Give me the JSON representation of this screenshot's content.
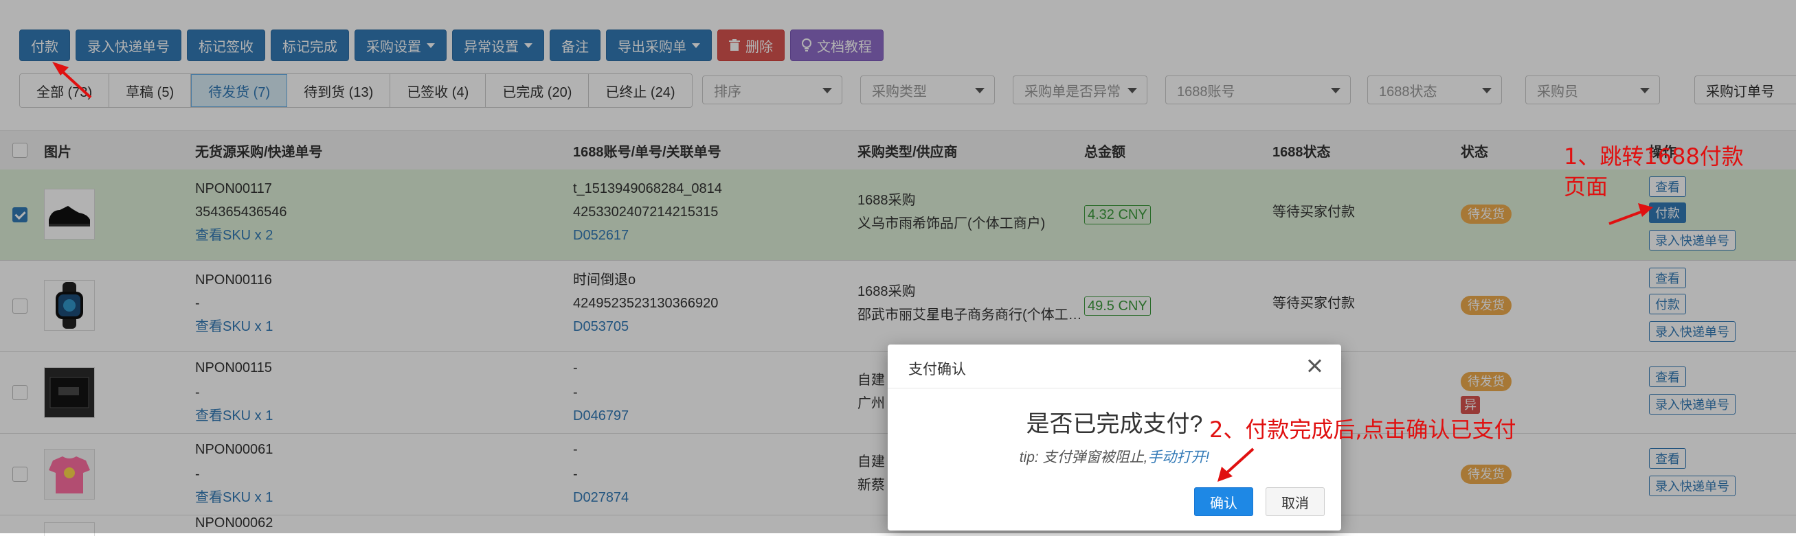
{
  "toolbar": {
    "buttons": [
      {
        "label": "付款"
      },
      {
        "label": "录入快递单号"
      },
      {
        "label": "标记签收"
      },
      {
        "label": "标记完成"
      },
      {
        "label": "采购设置"
      },
      {
        "label": "异常设置"
      },
      {
        "label": "备注"
      },
      {
        "label": "导出采购单"
      },
      {
        "label": "删除"
      },
      {
        "label": "文档教程"
      }
    ]
  },
  "tabs": [
    {
      "label": "全部 (73)"
    },
    {
      "label": "草稿 (5)"
    },
    {
      "label": "待发货 (7)",
      "active": true
    },
    {
      "label": "待到货 (13)"
    },
    {
      "label": "已签收 (4)"
    },
    {
      "label": "已完成 (20)"
    },
    {
      "label": "已终止 (24)"
    }
  ],
  "filters": {
    "sort": "排序",
    "purchase_type": "采购类型",
    "is_abnormal": "采购单是否异常",
    "account_1688": "1688账号",
    "status_1688": "1688状态",
    "buyer": "采购员",
    "search_field": "采购订单号"
  },
  "table": {
    "headers": {
      "image": "图片",
      "order_no": "无货源采购/快递单号",
      "account": "1688账号/单号/关联单号",
      "type_supplier": "采购类型/供应商",
      "total": "总金额",
      "status_1688": "1688状态",
      "status": "状态",
      "ops": "操作"
    },
    "rows": [
      {
        "order": "NPON00117",
        "express": "354365436546",
        "sku": "查看SKU x 2",
        "account": "t_1513949068284_0814",
        "order_1688": "4253302407214215315",
        "related": "D052617",
        "type": "1688采购",
        "supplier": "义乌市雨希饰品厂(个体工商户)",
        "amount": "4.32 CNY",
        "status_1688": "等待买家付款",
        "status": "待发货"
      },
      {
        "order": "NPON00116",
        "express": "-",
        "sku": "查看SKU x 1",
        "account": "时间倒退o",
        "order_1688": "4249523523130366920",
        "related": "D053705",
        "type": "1688采购",
        "supplier": "邵武市丽艾星电子商务商行(个体工…",
        "amount": "49.5 CNY",
        "status_1688": "等待买家付款",
        "status": "待发货"
      },
      {
        "order": "NPON00115",
        "express": "-",
        "sku": "查看SKU x 1",
        "account": "-",
        "order_1688": "-",
        "related": "D046797",
        "type": "自建",
        "supplier": "广州",
        "status": "待发货",
        "abnormal": "异"
      },
      {
        "order": "NPON00061",
        "express": "-",
        "sku": "查看SKU x 1",
        "account": "-",
        "order_1688": "-",
        "related": "D027874",
        "type": "自建",
        "supplier": "新蔡",
        "status": "待发货"
      },
      {
        "order": "NPON00062"
      }
    ],
    "ops": {
      "view": "查看",
      "pay": "付款",
      "express": "录入快递单号"
    }
  },
  "modal": {
    "title": "支付确认",
    "question": "是否已完成支付?",
    "tip_prefix": "tip: 支付弹窗被阻止,",
    "tip_link": "手动打开!",
    "confirm": "确认",
    "cancel": "取消"
  },
  "annotations": {
    "step1": "1、跳转1688付款\n页面",
    "step1_line1": "1、跳转1688付款",
    "step1_line2": "页面",
    "step2": "2、付款完成后,点击确认已支付",
    "color": "#e01010"
  },
  "colors": {
    "primary": "#337ab7",
    "danger": "#d9534f",
    "docs": "#8e6cc9",
    "selected_row": "#dff0d8",
    "badge": "#f0ad4e"
  }
}
